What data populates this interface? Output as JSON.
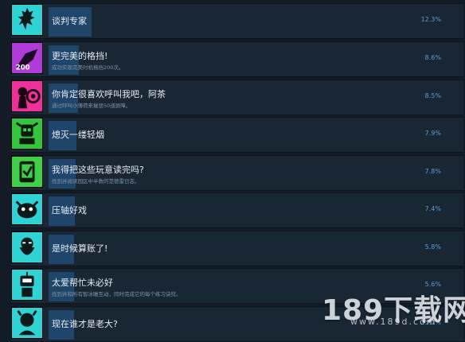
{
  "achievements": [
    {
      "title": "谈判专家",
      "desc": "",
      "percent": "12.3%",
      "fill": 0.123,
      "icon": "wolf-silhouette-icon",
      "color": "#2fd3d4"
    },
    {
      "title": "更完美的格挡!",
      "desc": "成功实现完美时机格挡200次。",
      "percent": "8.6%",
      "fill": 0.086,
      "icon": "parry-200-icon",
      "color": "#b13bd8"
    },
    {
      "title": "你肯定很喜欢呼叫我吧，阿茶",
      "desc": "通过呼叫小薄荷来摧毁50道屏障。",
      "percent": "8.5%",
      "fill": 0.085,
      "icon": "girl-with-robot-icon",
      "color": "#ef2f9a"
    },
    {
      "title": "熄灭一缕轻烟",
      "desc": "",
      "percent": "7.9%",
      "fill": 0.079,
      "icon": "skull-robot-icon",
      "color": "#33c53c"
    },
    {
      "title": "我得把这些玩意读完吗?",
      "desc": "找到并阅读园区中半数的范德雷日志。",
      "percent": "7.8%",
      "fill": 0.078,
      "icon": "phone-scroll-icon",
      "color": "#3fd145"
    },
    {
      "title": "压轴好戏",
      "desc": "",
      "percent": "7.4%",
      "fill": 0.074,
      "icon": "dragon-face-icon",
      "color": "#2fd3d4"
    },
    {
      "title": "是时候算账了!",
      "desc": "",
      "percent": "5.8%",
      "fill": 0.058,
      "icon": "bearded-boss-icon",
      "color": "#2fd3d4"
    },
    {
      "title": "太爱帮忙未必好",
      "desc": "找到并和所有智冰雕互动，同时完成它的每个练习诀窍。",
      "percent": "5.6%",
      "fill": 0.056,
      "icon": "robot-helper-icon",
      "color": "#2fd3d4"
    },
    {
      "title": "现在谁才是老大?",
      "desc": "",
      "percent": "5.1%",
      "fill": 0.051,
      "icon": "old-man-icon",
      "color": "#2fd3d4"
    }
  ],
  "watermark": {
    "text": "189下载网",
    "sub": "www.189d.com"
  }
}
